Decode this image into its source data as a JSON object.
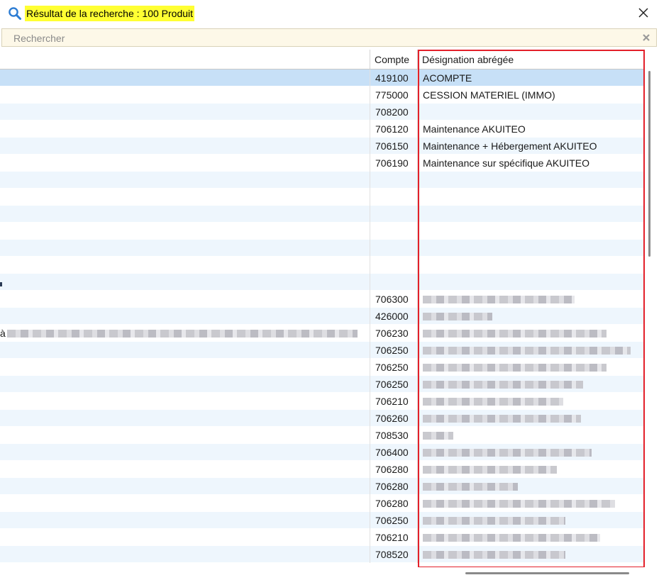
{
  "window": {
    "title": "Résultat de la recherche : 100 Produit"
  },
  "search": {
    "placeholder": "Rechercher",
    "value": ""
  },
  "table": {
    "columns": [
      "",
      "Compte",
      "Désignation abrégée"
    ],
    "rows": [
      {
        "col1": "",
        "compte": "419100",
        "designation": "ACOMPTE",
        "selected": true
      },
      {
        "col1": "",
        "compte": "775000",
        "designation": "CESSION MATERIEL (IMMO)"
      },
      {
        "col1": "",
        "compte": "708200",
        "designation": ""
      },
      {
        "col1": "",
        "compte": "706120",
        "designation": "Maintenance AKUITEO"
      },
      {
        "col1": "",
        "compte": "706150",
        "designation": "Maintenance + Hébergement AKUITEO"
      },
      {
        "col1": "",
        "compte": "706190",
        "designation": "Maintenance sur spécifique AKUITEO"
      },
      {
        "col1": "",
        "compte": "",
        "designation": ""
      },
      {
        "col1": "",
        "compte": "",
        "designation": ""
      },
      {
        "col1": "",
        "compte": "",
        "designation": ""
      },
      {
        "col1": "",
        "compte": "",
        "designation": ""
      },
      {
        "col1": "",
        "compte": "",
        "designation": ""
      },
      {
        "col1": "",
        "compte": "",
        "designation": ""
      },
      {
        "col1": "",
        "compte": "",
        "designation": ""
      },
      {
        "col1": "",
        "compte": "706300",
        "designation": "",
        "blur_designation": 0.7
      },
      {
        "col1": "",
        "compte": "426000",
        "designation": "",
        "blur_designation": 0.32
      },
      {
        "col1": "à",
        "compte": "706230",
        "designation": "",
        "blur_col1": 0.95,
        "blur_designation": 0.85
      },
      {
        "col1": "",
        "compte": "706250",
        "designation": "",
        "blur_designation": 0.96
      },
      {
        "col1": "",
        "compte": "706250",
        "designation": "",
        "blur_designation": 0.85
      },
      {
        "col1": "",
        "compte": "706250",
        "designation": "",
        "blur_designation": 0.74
      },
      {
        "col1": "",
        "compte": "706210",
        "designation": "",
        "blur_designation": 0.65
      },
      {
        "col1": "",
        "compte": "706260",
        "designation": "",
        "blur_designation": 0.73
      },
      {
        "col1": "",
        "compte": "708530",
        "designation": "",
        "blur_designation": 0.14
      },
      {
        "col1": "",
        "compte": "706400",
        "designation": "",
        "blur_designation": 0.78
      },
      {
        "col1": "",
        "compte": "706280",
        "designation": "",
        "blur_designation": 0.62
      },
      {
        "col1": "",
        "compte": "706280",
        "designation": "",
        "blur_designation": 0.44
      },
      {
        "col1": "",
        "compte": "706280",
        "designation": "",
        "blur_designation": 0.89
      },
      {
        "col1": "",
        "compte": "706250",
        "designation": "",
        "blur_designation": 0.66
      },
      {
        "col1": "",
        "compte": "706210",
        "designation": "",
        "blur_designation": 0.82
      },
      {
        "col1": "",
        "compte": "708520",
        "designation": "",
        "blur_designation": 0.66
      }
    ]
  },
  "colors": {
    "title_highlight": "#ffff33",
    "selection": "#c7e0f7",
    "alt_row": "#eef6fd",
    "annotation_box": "#e3202a",
    "search_bar_bg": "#fdf8e8",
    "search_icon": "#2b7cd3"
  },
  "icons": {
    "search": "search-icon",
    "close": "close-icon",
    "clear": "clear-icon"
  }
}
